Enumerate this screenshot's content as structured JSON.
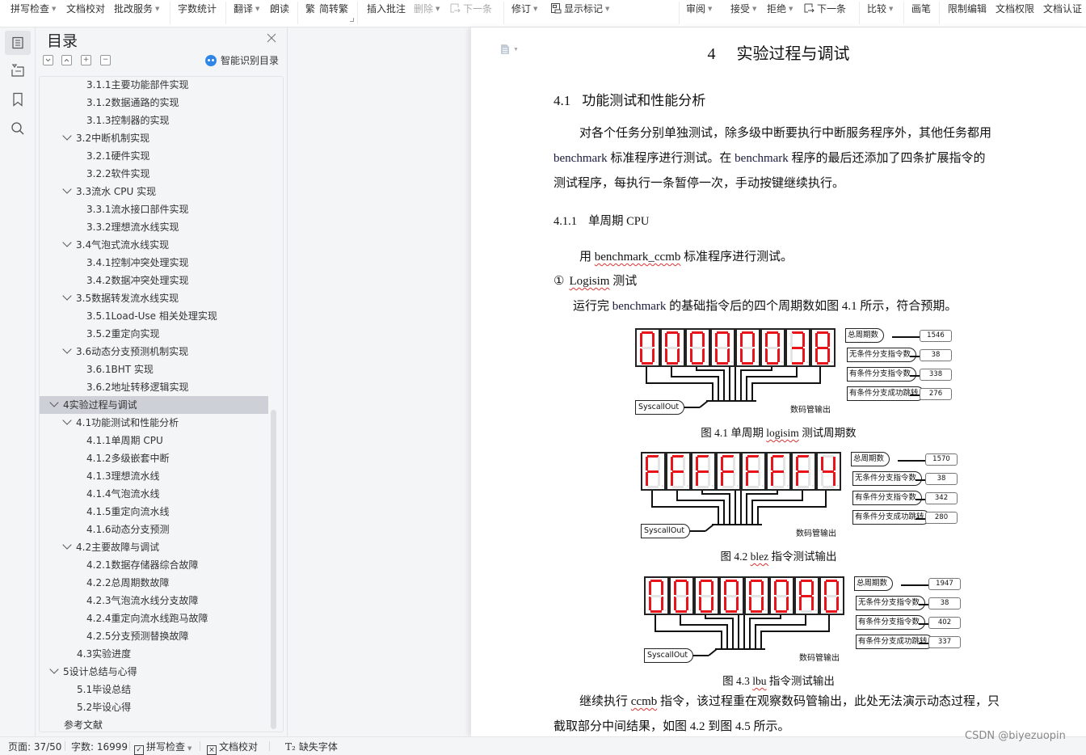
{
  "toolbar": {
    "items": [
      {
        "label": "拼写检查",
        "caret": true
      },
      {
        "label": "文档校对",
        "caret": false
      },
      {
        "label": "批改服务",
        "caret": true
      },
      {
        "label": "字数统计",
        "caret": false
      },
      {
        "label": "翻译",
        "caret": true
      },
      {
        "label": "朗读",
        "caret": false
      },
      {
        "label": "简转繁",
        "caret": false,
        "icon": "traditional-chinese-icon"
      },
      {
        "label": "插入批注",
        "caret": false
      },
      {
        "label": "删除",
        "caret": true,
        "disabled": true
      },
      {
        "label": "下一条",
        "caret": false,
        "disabled": true,
        "icon": "next-comment-icon"
      },
      {
        "label": "修订",
        "caret": true
      },
      {
        "label": "显示标记",
        "caret": true,
        "icon": "show-markup-icon"
      },
      {
        "label": "审阅",
        "caret": true
      },
      {
        "label": "接受",
        "caret": true
      },
      {
        "label": "拒绝",
        "caret": true
      },
      {
        "label": "下一条",
        "caret": false,
        "icon": "next-revision-icon"
      },
      {
        "label": "比较",
        "caret": true
      },
      {
        "label": "画笔",
        "caret": false
      },
      {
        "label": "限制编辑",
        "caret": false
      },
      {
        "label": "文档权限",
        "caret": false
      },
      {
        "label": "文档认证",
        "caret": false
      }
    ]
  },
  "rail": {
    "icons": [
      "toc-icon",
      "navigation-icon",
      "bookmark-icon",
      "search-icon"
    ]
  },
  "toc": {
    "title": "目录",
    "smart_label": "智能识别目录",
    "controls": [
      "collapse-down",
      "collapse-up",
      "expand-all",
      "collapse-all"
    ],
    "items": [
      {
        "label": "3.1.1主要功能部件实现",
        "level": 3
      },
      {
        "label": "3.1.2数据通路的实现",
        "level": 3
      },
      {
        "label": "3.1.3控制器的实现",
        "level": 3
      },
      {
        "label": "3.2中断机制实现",
        "level": 2,
        "expanded": true
      },
      {
        "label": "3.2.1硬件实现",
        "level": 3
      },
      {
        "label": "3.2.2软件实现",
        "level": 3
      },
      {
        "label": "3.3流水 CPU 实现",
        "level": 2,
        "expanded": true
      },
      {
        "label": "3.3.1流水接口部件实现",
        "level": 3
      },
      {
        "label": "3.3.2理想流水线实现",
        "level": 3
      },
      {
        "label": "3.4气泡式流水线实现",
        "level": 2,
        "expanded": true
      },
      {
        "label": "3.4.1控制冲突处理实现",
        "level": 3
      },
      {
        "label": "3.4.2数据冲突处理实现",
        "level": 3
      },
      {
        "label": "3.5数据转发流水线实现",
        "level": 2,
        "expanded": true
      },
      {
        "label": "3.5.1Load-Use 相关处理实现",
        "level": 3
      },
      {
        "label": "3.5.2重定向实现",
        "level": 3
      },
      {
        "label": "3.6动态分支预测机制实现",
        "level": 2,
        "expanded": true
      },
      {
        "label": "3.6.1BHT 实现",
        "level": 3
      },
      {
        "label": "3.6.2地址转移逻辑实现",
        "level": 3
      },
      {
        "label": "4实验过程与调试",
        "level": 1,
        "expanded": true,
        "selected": true
      },
      {
        "label": "4.1功能测试和性能分析",
        "level": 2,
        "expanded": true
      },
      {
        "label": "4.1.1单周期 CPU",
        "level": 3
      },
      {
        "label": "4.1.2多级嵌套中断",
        "level": 3
      },
      {
        "label": "4.1.3理想流水线",
        "level": 3
      },
      {
        "label": "4.1.4气泡流水线",
        "level": 3
      },
      {
        "label": "4.1.5重定向流水线",
        "level": 3
      },
      {
        "label": "4.1.6动态分支预测",
        "level": 3
      },
      {
        "label": "4.2主要故障与调试",
        "level": 2,
        "expanded": true
      },
      {
        "label": "4.2.1数据存储器综合故障",
        "level": 3
      },
      {
        "label": "4.2.2总周期数故障",
        "level": 3
      },
      {
        "label": "4.2.3气泡流水线分支故障",
        "level": 3
      },
      {
        "label": "4.2.4重定向流水线跑马故障",
        "level": 3
      },
      {
        "label": "4.2.5分支预测替换故障",
        "level": 3
      },
      {
        "label": "4.3实验进度",
        "level": 2
      },
      {
        "label": "5设计总结与心得",
        "level": 1,
        "expanded": true
      },
      {
        "label": "5.1毕设总结",
        "level": 2
      },
      {
        "label": "5.2毕设心得",
        "level": 2
      },
      {
        "label": "参考文献",
        "level": 1
      }
    ]
  },
  "document": {
    "chapter": {
      "num": "4",
      "title": "实验过程与调试"
    },
    "section": {
      "num": "4.1",
      "title": "功能测试和性能分析"
    },
    "para1": {
      "line1": "对各个任务分别单独测试，除多级中断要执行中断服务程序外，其他任务都用",
      "line2a": "benchmark",
      "line2b": " 标准程序进行测试。在 ",
      "line2c": "benchmark",
      "line2d": " 程序的最后还添加了四条扩展指令的",
      "line3": "测试程序，每执行一条暂停一次，手动按键继续执行。"
    },
    "subsection": {
      "num": "4.1.1",
      "title": "单周期 CPU"
    },
    "para2": {
      "pre": "用 ",
      "code": "benchmark_ccmb",
      "post": " 标准程序进行测试。"
    },
    "item1": {
      "marker": "①",
      "word": "Logisim",
      "rest": " 测试"
    },
    "para3": {
      "pre": "运行完 ",
      "word": "benchmark",
      "post": " 的基础指令后的四个周期数如图  4.1 所示，符合预期。"
    },
    "para4": {
      "pre": "继续执行 ",
      "word": "ccmb",
      "post": " 指令，该过程重在观察数码管输出，此处无法演示动态过程，只"
    },
    "para5": "截取部分中间结果，如图  4.2 到图  4.5 所示。"
  },
  "figures": [
    {
      "digits": "00000038",
      "syscall_label": "SyscallOut",
      "output_label": "数码管输出",
      "signals": [
        {
          "label": "总周期数",
          "value": "1546"
        },
        {
          "label": "无条件分支指令数",
          "value": "38"
        },
        {
          "label": "有条件分支指令数",
          "value": "338"
        },
        {
          "label": "有条件分支成功跳转",
          "value": "276"
        }
      ],
      "caption_pre": "图  4.1  单周期 ",
      "caption_word": "logisim",
      "caption_post": " 测试周期数"
    },
    {
      "digits": "FFFFFFF4",
      "syscall_label": "SyscallOut",
      "output_label": "数码管输出",
      "signals": [
        {
          "label": "总周期数",
          "value": "1570"
        },
        {
          "label": "无条件分支指令数",
          "value": "38"
        },
        {
          "label": "有条件分支指令数",
          "value": "342"
        },
        {
          "label": "有条件分支成功跳转",
          "value": "280"
        }
      ],
      "caption_pre": "图  4.2 ",
      "caption_word": "blez",
      "caption_post": " 指令测试输出"
    },
    {
      "digits": "000000A0",
      "syscall_label": "SyscallOut",
      "output_label": "数码管输出",
      "signals": [
        {
          "label": "总周期数",
          "value": "1947"
        },
        {
          "label": "无条件分支指令数",
          "value": "38"
        },
        {
          "label": "有条件分支指令数",
          "value": "402"
        },
        {
          "label": "有条件分支成功跳转",
          "value": "337"
        }
      ],
      "caption_pre": "图  4.3 ",
      "caption_word": "lbu",
      "caption_post": " 指令测试输出"
    }
  ],
  "statusbar": {
    "page": "页面: 37/50",
    "words": "字数: 16999",
    "spell": "拼写检查",
    "proof": "文档校对",
    "font": "缺失字体"
  },
  "watermark": "CSDN @biyezuopin",
  "colors": {
    "segment_on": "#e8141a",
    "segment_off": "#e4e4e4",
    "accent": "#2e86e8",
    "selected_row": "#cdd1d7"
  }
}
